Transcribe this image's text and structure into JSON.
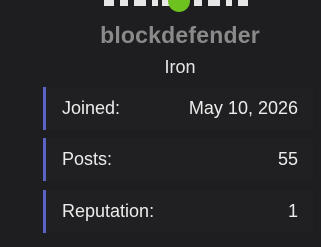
{
  "profile": {
    "username": "blockdefender",
    "rank": "Iron",
    "status_color": "#6ec21f"
  },
  "stats": [
    {
      "label": "Joined:",
      "value": "May 10, 2026"
    },
    {
      "label": "Posts:",
      "value": "55"
    },
    {
      "label": "Reputation:",
      "value": "1"
    }
  ],
  "colors": {
    "background": "#1c1c1e",
    "accent_border": "#5b63c6",
    "username": "#8a8a8a"
  }
}
